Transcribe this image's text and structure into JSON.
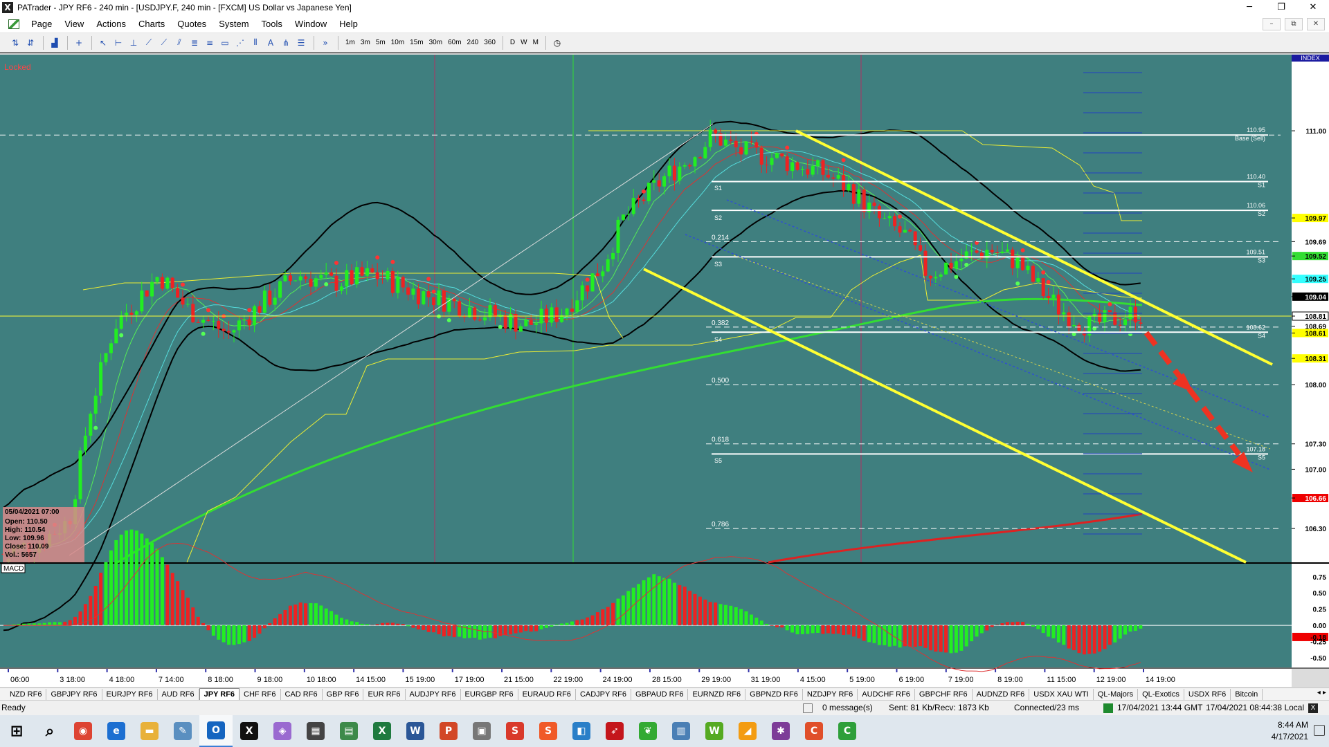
{
  "window": {
    "title": "PATrader - JPY RF6 - 240 min - [USDJPY.F, 240 min - [FXCM] US Dollar vs Japanese Yen]",
    "app_icon": "X",
    "minimize": "─",
    "restore": "❐",
    "close": "✕"
  },
  "menu": {
    "items": [
      "Page",
      "View",
      "Actions",
      "Charts",
      "Quotes",
      "System",
      "Tools",
      "Window",
      "Help"
    ],
    "mdi_minimize": "–",
    "mdi_restore": "⧉",
    "mdi_close": "✕"
  },
  "toolbar": {
    "timeframes": [
      "1m",
      "3m",
      "5m",
      "10m",
      "15m",
      "30m",
      "60m",
      "240",
      "360"
    ],
    "periods": [
      "D",
      "W",
      "M"
    ],
    "more": "»"
  },
  "chart": {
    "locked_label": "Locked",
    "index_label": "INDEX",
    "macd_label": "MACD",
    "colors": {
      "background": "#3f7f7f",
      "axis_background": "#ffffff",
      "bull": "#22ee22",
      "bear": "#ee2222",
      "channel": "#ffff33",
      "ma_slow": "#33dd33",
      "ma_long": "#dd2222"
    },
    "price_axis": [
      {
        "label": "111.00",
        "price": 111.0,
        "kind": "tick"
      },
      {
        "label": "109.97",
        "price": 109.97,
        "kind": "tag",
        "bg": "#ffff00"
      },
      {
        "label": "109.69",
        "price": 109.69,
        "kind": "tick"
      },
      {
        "label": "109.52",
        "price": 109.52,
        "kind": "tag",
        "bg": "#33dd33"
      },
      {
        "label": "109.25",
        "price": 109.25,
        "kind": "tag",
        "bg": "#33ffff"
      },
      {
        "label": "109.04",
        "price": 109.04,
        "kind": "tag",
        "bg": "#000000",
        "fg": "#ffffff"
      },
      {
        "label": "108.81",
        "price": 108.81,
        "kind": "tag",
        "bg": "#ffffff",
        "border": "#000000"
      },
      {
        "label": "108.69",
        "price": 108.69,
        "kind": "tick"
      },
      {
        "label": "108.61",
        "price": 108.61,
        "kind": "tag",
        "bg": "#ffff00"
      },
      {
        "label": "108.31",
        "price": 108.31,
        "kind": "tag",
        "bg": "#ffff00"
      },
      {
        "label": "108.00",
        "price": 108.0,
        "kind": "tick"
      },
      {
        "label": "107.30",
        "price": 107.3,
        "kind": "tick"
      },
      {
        "label": "107.00",
        "price": 107.0,
        "kind": "tick"
      },
      {
        "label": "106.66",
        "price": 106.66,
        "kind": "tag",
        "bg": "#ee0000",
        "fg": "#ffffff"
      },
      {
        "label": "106.30",
        "price": 106.3,
        "kind": "tick"
      }
    ],
    "macd_axis": [
      {
        "label": "0.75",
        "value": 0.75
      },
      {
        "label": "0.50",
        "value": 0.5
      },
      {
        "label": "0.25",
        "value": 0.25
      },
      {
        "label": "0.00",
        "value": 0.0
      },
      {
        "label": "-0.18",
        "value": -0.18,
        "tag": true
      },
      {
        "label": "-0.25",
        "value": -0.25
      },
      {
        "label": "-0.50",
        "value": -0.5
      }
    ],
    "time_axis": [
      "06:00",
      "3 18:00",
      "4 18:00",
      "7 14:00",
      "8 18:00",
      "9 18:00",
      "10 18:00",
      "14 15:00",
      "15 19:00",
      "17 19:00",
      "21 15:00",
      "22 19:00",
      "24 19:00",
      "28 15:00",
      "29 19:00",
      "31 19:00",
      "4 15:00",
      "5 19:00",
      "6 19:00",
      "7 19:00",
      "8 19:00",
      "11 15:00",
      "12 19:00",
      "14 19:00"
    ],
    "fib_levels": [
      {
        "label": "0.214",
        "price": 109.69
      },
      {
        "label": "0.382",
        "price": 108.68
      },
      {
        "label": "0.500",
        "price": 108.0
      },
      {
        "label": "0.618",
        "price": 107.3
      },
      {
        "label": "0.786",
        "price": 106.3
      }
    ],
    "pivot_levels": [
      {
        "value": "110.95",
        "tag": "Base (Sell)",
        "price": 110.95
      },
      {
        "value": "110.40",
        "tag": "S1",
        "price": 110.4
      },
      {
        "value": "110.06",
        "tag": "S2",
        "price": 110.06
      },
      {
        "value": "109.51",
        "tag": "S3",
        "price": 109.51
      },
      {
        "value": "108.62",
        "tag": "S4",
        "price": 108.62
      },
      {
        "value": "107.18",
        "tag": "S5",
        "price": 107.18
      }
    ],
    "left_pivot_tags": [
      {
        "tag": "S1",
        "price": 110.38
      },
      {
        "tag": "S2",
        "price": 110.03
      },
      {
        "tag": "S3",
        "price": 109.48
      },
      {
        "tag": "S4",
        "price": 108.59
      },
      {
        "tag": "S5",
        "price": 107.16
      }
    ],
    "ohlc": {
      "date": "05/04/2021 07:00",
      "open": "Open: 110.50",
      "high": "High: 110.54",
      "low": "Low: 109.96",
      "close": "Close: 110.09",
      "volume": "Vol.: 5657"
    }
  },
  "tabs": {
    "items": [
      "NZD RF6",
      "GBPJPY RF6",
      "EURJPY RF6",
      "AUD RF6",
      "JPY RF6",
      "CHF RF6",
      "CAD RF6",
      "GBP RF6",
      "EUR RF6",
      "AUDJPY RF6",
      "EURGBP RF6",
      "EURAUD RF6",
      "CADJPY RF6",
      "GBPAUD RF6",
      "EURNZD RF6",
      "GBPNZD RF6",
      "NZDJPY RF6",
      "AUDCHF RF6",
      "GBPCHF RF6",
      "AUDNZD RF6",
      "USDX XAU WTI",
      "QL-Majors",
      "QL-Exotics",
      "USDX RF6",
      "Bitcoin"
    ],
    "active": "JPY RF6",
    "arrows": "◂ ▸"
  },
  "status": {
    "ready": "Ready",
    "messages": "0 message(s)",
    "traffic": "Sent: 81 Kb/Recv: 1873 Kb",
    "connection": "Connected/23 ms",
    "gmt": "17/04/2021 13:44 GMT",
    "local": "17/04/2021 08:44:38 Local"
  },
  "taskbar": {
    "icons": [
      {
        "name": "windows-start-icon",
        "glyph": "⊞",
        "color": "#000000"
      },
      {
        "name": "search-icon",
        "glyph": "⌕",
        "color": "#000000"
      },
      {
        "name": "chrome-icon",
        "glyph": "◉",
        "color": "#dd4433"
      },
      {
        "name": "edge-icon",
        "glyph": "e",
        "color": "#1c6fd1"
      },
      {
        "name": "file-explorer-icon",
        "glyph": "▬",
        "color": "#e8b13a"
      },
      {
        "name": "notepad-icon",
        "glyph": "✎",
        "color": "#5a8fc0"
      },
      {
        "name": "outlook-icon",
        "glyph": "O",
        "color": "#1565c0"
      },
      {
        "name": "patrader-icon",
        "glyph": "X",
        "color": "#111111"
      },
      {
        "name": "photos-icon",
        "glyph": "◈",
        "color": "#9a6ad0"
      },
      {
        "name": "calculator-icon",
        "glyph": "▦",
        "color": "#444444"
      },
      {
        "name": "sticky-app-icon",
        "glyph": "▤",
        "color": "#3d8a4a"
      },
      {
        "name": "excel-icon",
        "glyph": "X",
        "color": "#1f7a3f"
      },
      {
        "name": "word-icon",
        "glyph": "W",
        "color": "#2b5797"
      },
      {
        "name": "powerpoint-icon",
        "glyph": "P",
        "color": "#d24726"
      },
      {
        "name": "folder-icon",
        "glyph": "▣",
        "color": "#777777"
      },
      {
        "name": "snagit-icon",
        "glyph": "S",
        "color": "#d93a2b"
      },
      {
        "name": "snagit-editor-icon",
        "glyph": "S",
        "color": "#f05a28"
      },
      {
        "name": "network-icon",
        "glyph": "◧",
        "color": "#2a7fc8"
      },
      {
        "name": "bird-icon",
        "glyph": "➶",
        "color": "#c4161c"
      },
      {
        "name": "leaf-icon",
        "glyph": "❦",
        "color": "#33aa33"
      },
      {
        "name": "document-icon",
        "glyph": "▥",
        "color": "#4a7fb5"
      },
      {
        "name": "webull-icon",
        "glyph": "W",
        "color": "#55aa22"
      },
      {
        "name": "chart-app-icon",
        "glyph": "◢",
        "color": "#f39c12"
      },
      {
        "name": "slack-icon",
        "glyph": "✱",
        "color": "#7d3c98"
      },
      {
        "name": "camtasia-icon",
        "glyph": "C",
        "color": "#e04f2a"
      },
      {
        "name": "camtasia-rec-icon",
        "glyph": "C",
        "color": "#2e9f3a"
      }
    ],
    "time": "8:44 AM",
    "date": "4/17/2021"
  }
}
